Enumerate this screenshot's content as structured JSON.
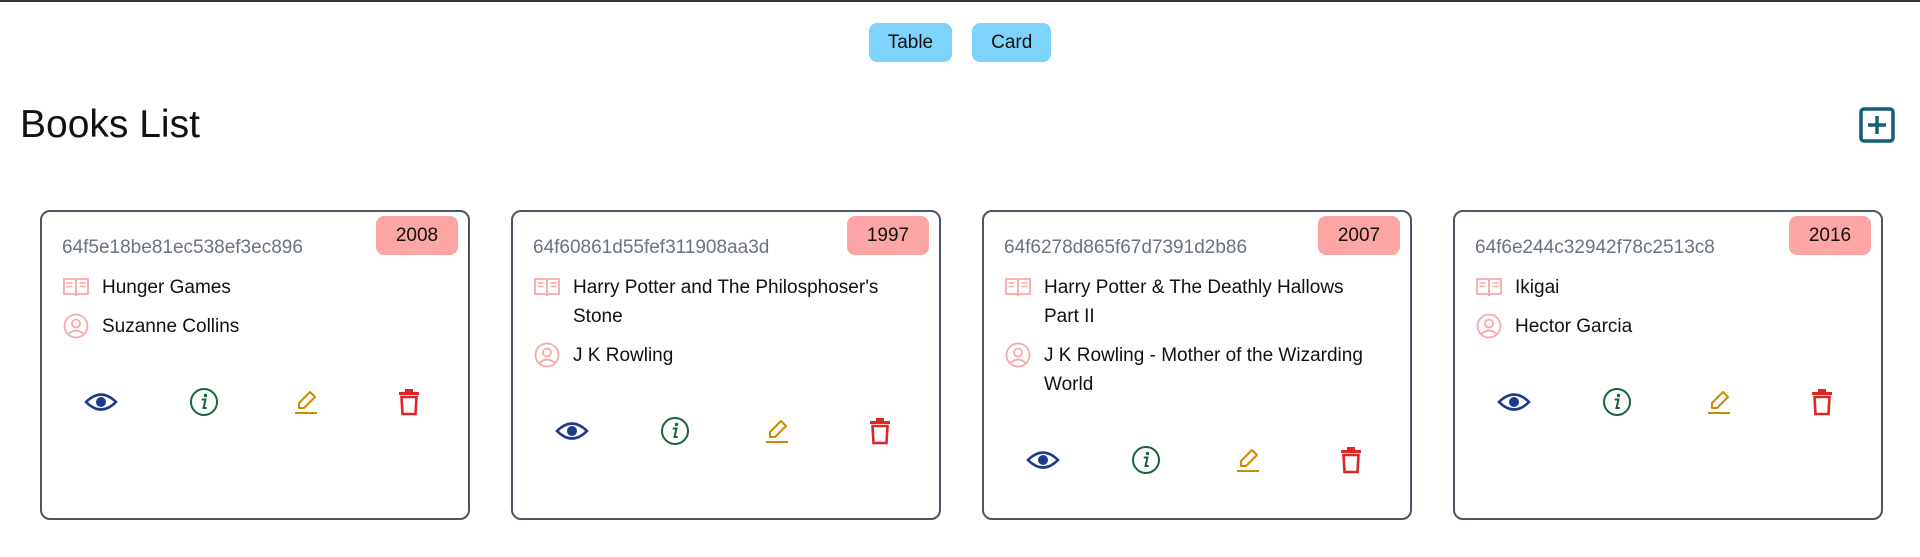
{
  "view_toggle": {
    "table_label": "Table",
    "card_label": "Card"
  },
  "page": {
    "title": "Books List"
  },
  "colors": {
    "toggle_bg": "#7dd3fc",
    "badge_bg": "#fca5a5",
    "view": "#1e3a8a",
    "info": "#166534",
    "edit": "#ca8a04",
    "delete": "#dc2626",
    "add": "#155e75",
    "meta_icon": "#f9a8a8"
  },
  "icons": {
    "add": "plus-square-icon",
    "book": "open-book-icon",
    "author": "user-circle-icon",
    "view": "eye-icon",
    "info": "info-circle-icon",
    "edit": "pencil-icon",
    "delete": "trash-icon"
  },
  "books": [
    {
      "id": "64f5e18be81ec538ef3ec896",
      "year": "2008",
      "title": "Hunger Games",
      "author": "Suzanne Collins"
    },
    {
      "id": "64f60861d55fef311908aa3d",
      "year": "1997",
      "title": "Harry Potter and The Philosphoser's Stone",
      "author": "J K Rowling"
    },
    {
      "id": "64f6278d865f67d7391d2b86",
      "year": "2007",
      "title": "Harry Potter & The Deathly Hallows Part II",
      "author": "J K Rowling - Mother of the Wizarding World"
    },
    {
      "id": "64f6e244c32942f78c2513c8",
      "year": "2016",
      "title": "Ikigai",
      "author": "Hector Garcia"
    }
  ]
}
